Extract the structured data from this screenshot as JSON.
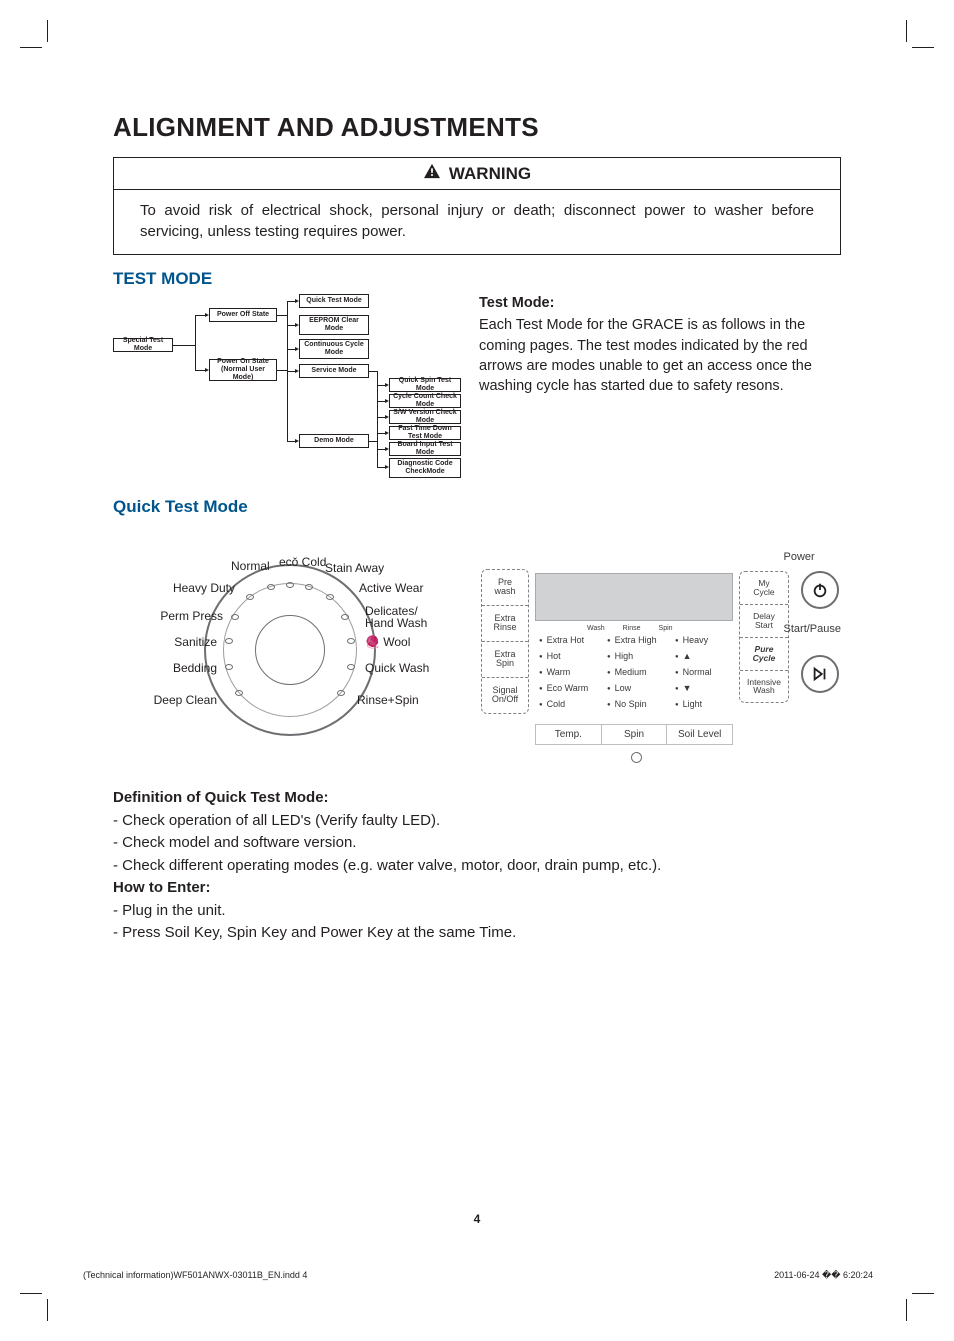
{
  "page_title": "ALIGNMENT AND ADJUSTMENTS",
  "warning": {
    "label": "WARNING",
    "body": "To avoid risk of electrical shock, personal injury or death; disconnect power to washer before servicing, unless testing requires power."
  },
  "test_mode": {
    "heading": "TEST MODE",
    "desc_heading": "Test Mode:",
    "desc_body": "Each Test Mode for the GRACE is as follows in the coming pages.  The test modes indicated by the red arrows are modes unable to get an access once the washing cycle has started due to safety resons."
  },
  "flowchart": {
    "special": "Special Test Mode",
    "power_off": "Power Off State",
    "power_on": "Power On State (Normal User Mode)",
    "quick": "Quick Test Mode",
    "eeprom": "EEPROM Clear Mode",
    "cont": "Continuous Cycle Mode",
    "service": "Service Mode",
    "demo": "Demo Mode",
    "quick_spin": "Quick Spin Test Mode",
    "cycle_count": "Cycle Count Check Mode",
    "sw_ver": "S/W Version Check Mode",
    "fast_time": "Fast Time Down Test Mode",
    "board_input": "Board Input Test Mode",
    "diag": "Diagnostic Code CheckMode"
  },
  "quick_test": {
    "heading": "Quick Test Mode"
  },
  "dial": {
    "labels": [
      "Normal",
      "ecǒ Cold",
      "Stain Away",
      "Active Wear",
      "Delicates/\nHand Wash",
      "🧶 Wool",
      "Quick Wash",
      "Rinse+Spin",
      "Deep Clean",
      "Bedding",
      "Sanitize",
      "Perm Press",
      "Heavy Duty"
    ]
  },
  "panel": {
    "left_opts": [
      "Pre\nwash",
      "Extra\nRinse",
      "Extra\nSpin",
      "Signal\nOn/Off"
    ],
    "seg_headers": [
      "Wash",
      "Rinse",
      "Spin"
    ],
    "temp": [
      "Extra Hot",
      "Hot",
      "Warm",
      "Eco Warm",
      "Cold"
    ],
    "spin": [
      "Extra High",
      "High",
      "Medium",
      "Low",
      "No Spin"
    ],
    "soil": [
      "Heavy",
      "▲",
      "Normal",
      "▼",
      "Light"
    ],
    "bottom": [
      "Temp.",
      "Spin",
      "Soil Level"
    ],
    "mid_opts": [
      "My\nCycle",
      "Delay\nStart",
      "Pure\nCycle",
      "Intensive\nWash"
    ],
    "right": {
      "power": "Power",
      "start": "Start/Pause"
    }
  },
  "definition": {
    "heading": "Definition of Quick Test Mode:",
    "items": [
      "Check operation of all LED's (Verify faulty LED).",
      "Check model and software version.",
      "Check different operating modes (e.g. water valve, motor, door, drain pump, etc.)."
    ],
    "enter_heading": "How to Enter:",
    "enter_items": [
      "Plug in the unit.",
      "Press Soil Key, Spin Key and Power Key at the same Time."
    ]
  },
  "page_number": "4",
  "footer": {
    "left": "(Technical information)WF501ANWX-03011B_EN.indd   4",
    "right": "2011-06-24   �� 6:20:24"
  }
}
